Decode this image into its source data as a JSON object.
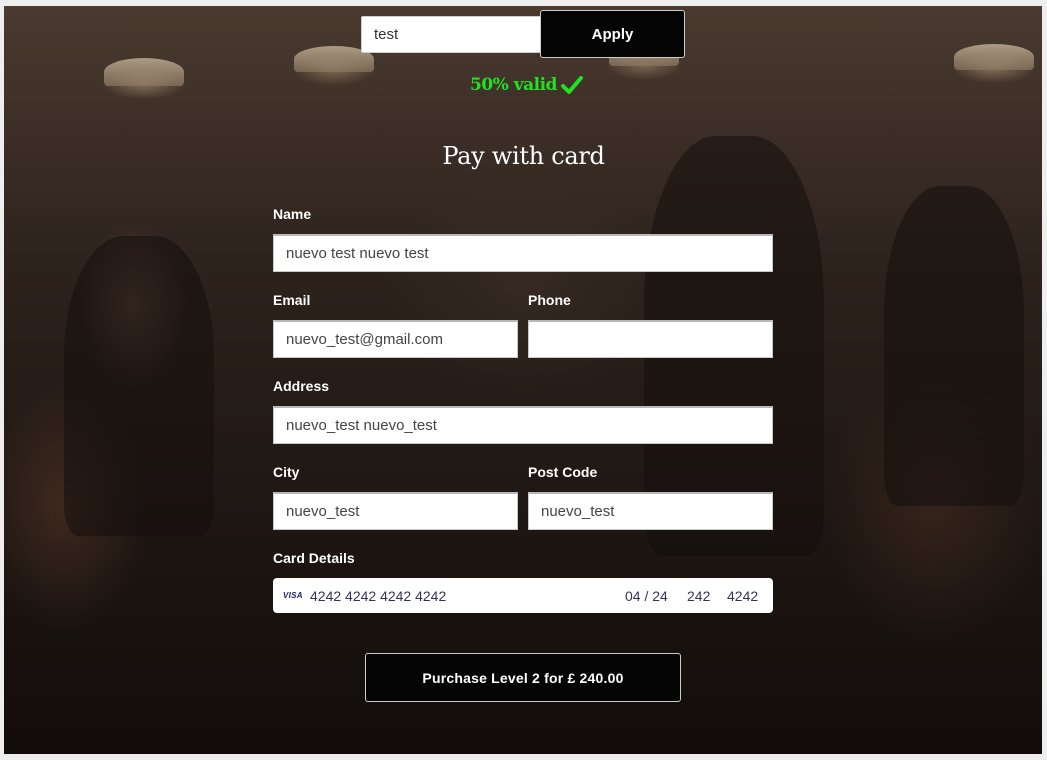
{
  "coupon": {
    "value": "test",
    "apply_label": "Apply",
    "status_text": "50% valid",
    "status_color": "#22e022"
  },
  "form": {
    "title": "Pay with card",
    "name": {
      "label": "Name",
      "value": "nuevo test nuevo test"
    },
    "email": {
      "label": "Email",
      "value": "nuevo_test@gmail.com"
    },
    "phone": {
      "label": "Phone",
      "value": ""
    },
    "address": {
      "label": "Address",
      "value": "nuevo_test nuevo_test"
    },
    "city": {
      "label": "City",
      "value": "nuevo_test"
    },
    "postcode": {
      "label": "Post Code",
      "value": "nuevo_test"
    },
    "card": {
      "label": "Card Details",
      "brand": "VISA",
      "number": "4242 4242 4242 4242",
      "expiry": "04 / 24",
      "cvc": "242",
      "zip": "4242"
    },
    "purchase_label": "Purchase Level 2 for £ 240.00"
  },
  "icons": {
    "valid": "checkmark-icon",
    "card_brand": "visa-icon"
  }
}
